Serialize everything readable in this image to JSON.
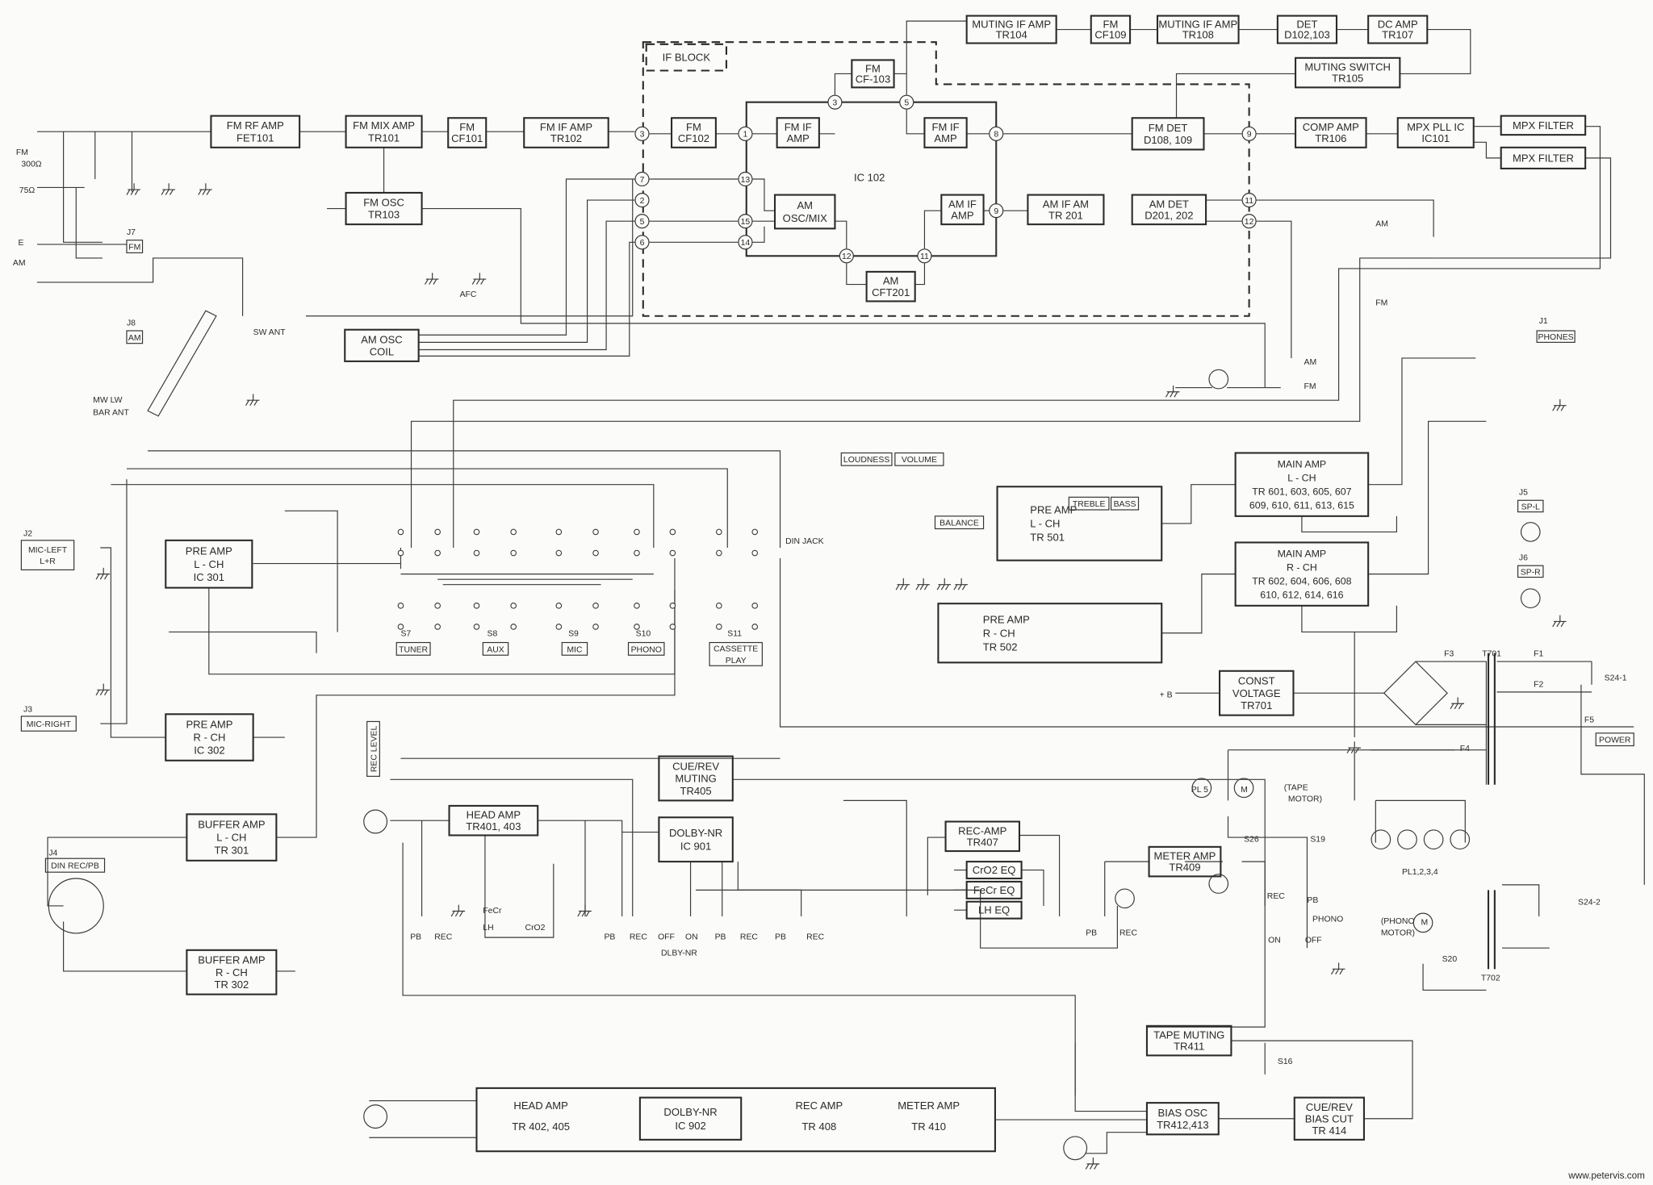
{
  "diagram": {
    "blocks": {
      "fm_rf_amp": {
        "lines": [
          "FM RF AMP",
          "FET101"
        ]
      },
      "fm_mix_amp": {
        "lines": [
          "FM MIX AMP",
          "TR101"
        ]
      },
      "fm_cf101": {
        "lines": [
          "FM",
          "CF101"
        ]
      },
      "fm_if_amp_tr102": {
        "lines": [
          "FM IF AMP",
          "TR102"
        ]
      },
      "fm_osc": {
        "lines": [
          "FM OSC",
          "TR103"
        ]
      },
      "am_osc_coil": {
        "lines": [
          "AM OSC",
          "COIL"
        ]
      },
      "if_block_label": {
        "lines": [
          "IF BLOCK"
        ]
      },
      "fm_cf102": {
        "lines": [
          "FM",
          "CF102"
        ]
      },
      "fm_if_amp_1": {
        "lines": [
          "FM IF",
          "AMP"
        ]
      },
      "fm_cf103": {
        "lines": [
          "FM",
          "CF-103"
        ]
      },
      "fm_if_amp_2": {
        "lines": [
          "FM IF",
          "AMP"
        ]
      },
      "am_osc_mix": {
        "lines": [
          "AM",
          "OSC/MIX"
        ]
      },
      "am_if_amp": {
        "lines": [
          "AM IF",
          "AMP"
        ]
      },
      "am_cft201": {
        "lines": [
          "AM",
          "CFT201"
        ]
      },
      "am_if_am": {
        "lines": [
          "AM IF AM",
          "TR 201"
        ]
      },
      "am_det": {
        "lines": [
          "AM DET",
          "D201, 202"
        ]
      },
      "fm_det": {
        "lines": [
          "FM DET",
          "D108, 109"
        ]
      },
      "muting_if_amp_tr104": {
        "lines": [
          "MUTING IF AMP",
          "TR104"
        ]
      },
      "fm_cf109": {
        "lines": [
          "FM",
          "CF109"
        ]
      },
      "muting_if_amp_tr108": {
        "lines": [
          "MUTING IF AMP",
          "TR108"
        ]
      },
      "det": {
        "lines": [
          "DET",
          "D102,103"
        ]
      },
      "dc_amp": {
        "lines": [
          "DC AMP",
          "TR107"
        ]
      },
      "muting_switch": {
        "lines": [
          "MUTING SWITCH",
          "TR105"
        ]
      },
      "comp_amp": {
        "lines": [
          "COMP AMP",
          "TR106"
        ]
      },
      "mpx_pll": {
        "lines": [
          "MPX PLL IC",
          "IC101"
        ]
      },
      "mpx_filter_1": {
        "lines": [
          "MPX FILTER"
        ]
      },
      "mpx_filter_2": {
        "lines": [
          "MPX FILTER"
        ]
      },
      "pre_amp_ic301": {
        "lines": [
          "PRE AMP",
          "L - CH",
          "IC 301"
        ]
      },
      "pre_amp_ic302": {
        "lines": [
          "PRE AMP",
          "R - CH",
          "IC 302"
        ]
      },
      "buffer_amp_l": {
        "lines": [
          "BUFFER AMP",
          "L - CH",
          "TR 301"
        ]
      },
      "buffer_amp_r": {
        "lines": [
          "BUFFER AMP",
          "R - CH",
          "TR 302"
        ]
      },
      "pre_amp_tr501": {
        "lines": [
          "PRE AMP",
          "L - CH",
          "TR 501"
        ]
      },
      "pre_amp_tr502": {
        "lines": [
          "PRE AMP",
          "R - CH",
          "TR 502"
        ]
      },
      "main_amp_l": {
        "lines": [
          "MAIN AMP",
          "L - CH",
          "TR 601, 603, 605, 607",
          "609, 610, 611, 613, 615"
        ]
      },
      "main_amp_r": {
        "lines": [
          "MAIN AMP",
          "R - CH",
          "TR 602, 604, 606, 608",
          "610, 612, 614, 616"
        ]
      },
      "const_voltage": {
        "lines": [
          "CONST",
          "VOLTAGE",
          "TR701"
        ]
      },
      "cue_rev_muting": {
        "lines": [
          "CUE/REV",
          "MUTING",
          "TR405"
        ]
      },
      "head_amp_tr401": {
        "lines": [
          "HEAD AMP",
          "TR401, 403"
        ]
      },
      "dolby_ic901": {
        "lines": [
          "DOLBY-NR",
          "IC 901"
        ]
      },
      "rec_amp_tr407": {
        "lines": [
          "REC-AMP",
          "TR407"
        ]
      },
      "cro2_eq": {
        "lines": [
          "CrO2 EQ"
        ]
      },
      "fecr_eq": {
        "lines": [
          "FeCr EQ"
        ]
      },
      "lh_eq": {
        "lines": [
          "LH  EQ"
        ]
      },
      "meter_amp_tr409": {
        "lines": [
          "METER AMP",
          "TR409"
        ]
      },
      "tape_muting": {
        "lines": [
          "TAPE MUTING",
          "TR411"
        ]
      },
      "bias_osc": {
        "lines": [
          "BIAS OSC",
          "TR412,413"
        ]
      },
      "cue_rev_bias_cut": {
        "lines": [
          "CUE/REV",
          "BIAS CUT",
          "TR 414"
        ]
      },
      "r_channel_deck": {
        "lines": []
      },
      "dolby_ic902": {
        "lines": [
          "DOLBY-NR",
          "IC 902"
        ]
      }
    },
    "deck_r_labels": {
      "head_amp": [
        "HEAD AMP",
        "TR 402, 405"
      ],
      "rec_amp": [
        "REC AMP",
        "TR 408"
      ],
      "meter_amp": [
        "METER AMP",
        "TR 410"
      ]
    },
    "ic102_label": "IC 102",
    "boxed_labels": {
      "j7_fm": [
        "FM"
      ],
      "j8_am": [
        "AM"
      ],
      "j1_phones": [
        "PHONES"
      ],
      "j5_spl": [
        "SP-L"
      ],
      "j6_spr": [
        "SP-R"
      ],
      "j2_mic_left": [
        "MIC-LEFT",
        "L+R"
      ],
      "j3_mic_right": [
        "MIC-RIGHT"
      ],
      "j4_din": [
        "DIN REC/PB"
      ],
      "s7_tuner": [
        "TUNER"
      ],
      "s8_aux": [
        "AUX"
      ],
      "s9_mic": [
        "MIC"
      ],
      "s10_phono": [
        "PHONO"
      ],
      "s11_cassette": [
        "CASSETTE",
        "PLAY"
      ],
      "loudness": [
        "LOUDNESS"
      ],
      "volume": [
        "VOLUME"
      ],
      "balance": [
        "BALANCE"
      ],
      "treble": [
        "TREBLE"
      ],
      "bass": [
        "BASS"
      ],
      "power": [
        "POWER"
      ],
      "rec_level": [
        "REC LEVEL"
      ]
    },
    "labels": {
      "fm": "FM",
      "ohm300": "300Ω",
      "ohm75": "75Ω",
      "e": "E",
      "am": "AM",
      "j7": "J7",
      "j8": "J8",
      "mw_lw": "MW LW",
      "bar_ant": "BAR ANT",
      "sw_ant": "SW ANT",
      "afc": "AFC",
      "sw_am1": "AM",
      "sw_fm1": "FM",
      "sw_am2": "AM",
      "sw_fm2": "FM",
      "j1": "J1",
      "j5": "J5",
      "j6": "J6",
      "j2": "J2",
      "j3": "J3",
      "j4": "J4",
      "s7": "S7",
      "s8": "S8",
      "s9": "S9",
      "s10": "S10",
      "s11": "S11",
      "din_jack": "DIN JACK",
      "plus_b": "+ B",
      "f3": "F3",
      "t701": "T701",
      "f1": "F1",
      "f2": "F2",
      "s24_1": "S24-1",
      "f5": "F5",
      "f4": "F4",
      "pl5": "PL 5",
      "tape_motor_1": "(TAPE",
      "tape_motor_2": "MOTOR)",
      "s26": "S26",
      "s19": "S19",
      "rec_sw": "REC",
      "pb_sw": "PB",
      "phono_sw": "PHONO",
      "on_sw": "ON",
      "off_sw": "OFF",
      "pl1234": "PL1,2,3,4",
      "s24_2": "S24-2",
      "phono_motor_1": "(PHONO",
      "phono_motor_2": "MOTOR)",
      "s20": "S20",
      "t702": "T702",
      "s16": "S16",
      "pb1": "PB",
      "rec1": "REC",
      "fecr": "FeCr",
      "lh": "LH",
      "cro2": "CrO2",
      "pb2": "PB",
      "rec2": "REC",
      "off_d": "OFF",
      "on_d": "ON",
      "dlby_nr": "DLBY-NR",
      "pb3": "PB",
      "rec3": "REC",
      "pb4": "PB",
      "rec4": "REC",
      "pb5": "PB",
      "rec5": "REC",
      "motor_m1": "M",
      "motor_m2": "M",
      "watermark": "www.petervis.com"
    },
    "pins": {
      "p3a": "3",
      "p7": "7",
      "p2": "2",
      "p5a": "5",
      "p6": "6",
      "p1": "1",
      "p13": "13",
      "p15": "15",
      "p14": "14",
      "p3b": "3",
      "p5b": "5",
      "p8": "8",
      "p9a": "9",
      "p12a": "12",
      "p11a": "11",
      "p9b": "9",
      "p11b": "11",
      "p12b": "12"
    },
    "colors": {
      "ink": "#2b2b2b",
      "paper": "#fbfbf9"
    }
  }
}
